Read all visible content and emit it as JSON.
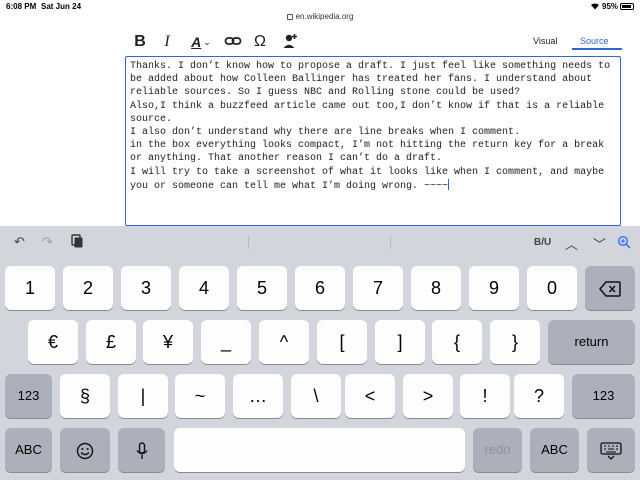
{
  "status": {
    "time": "6:08 PM",
    "date": "Sat Jun 24",
    "battery": "95%"
  },
  "url": "en.wikipedia.org",
  "toolbar": {
    "bold": "B",
    "italic": "I",
    "style": "A",
    "omega": "Ω",
    "tabs": {
      "visual": "Visual",
      "source": "Source"
    }
  },
  "editor": {
    "text": "Thanks. I don’t know how to propose a draft. I just feel like something needs to be added about how Colleen Ballinger has treated her fans. I understand about reliable sources. So I guess NBC and Rolling stone could be used?\nAlso,I think a buzzfeed article came out too,I don’t know if that is a reliable source.\nI also don’t understand why there are line breaks when I comment.\nin the box everything looks compact, I’m not hitting the return key for a break or anything. That another reason I can’t do a draft.\nI will try to take a screenshot of what it looks like when I comment, and maybe you or someone can tell me what I’m doing wrong. ~~~~"
  },
  "keyboard": {
    "toolbar": {
      "format": "B/U"
    },
    "row1": [
      "1",
      "2",
      "3",
      "4",
      "5",
      "6",
      "7",
      "8",
      "9",
      "0"
    ],
    "row2": [
      "€",
      "£",
      "¥",
      "_",
      "^",
      "[",
      "]",
      "{",
      "}"
    ],
    "return_label": "return",
    "row3": [
      "§",
      "|",
      "~",
      "…",
      "\\",
      "<",
      ">",
      "!",
      "?"
    ],
    "mode_label": "123",
    "abc_label": "ABC",
    "redo_label": "redo"
  },
  "colors": {
    "accent": "#3366cc",
    "keyboard_bg": "#d2d5db",
    "key_dark": "#abb0ba"
  }
}
